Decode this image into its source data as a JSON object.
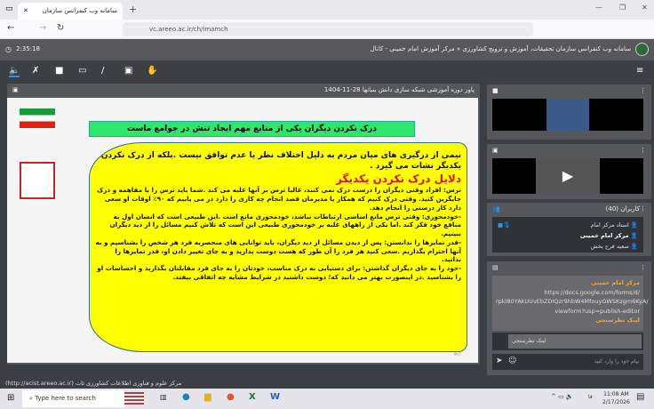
{
  "browser": {
    "tab_title": "سامانه وب کنفرانس سازمان",
    "url": "vc.areeo.ac.ir/ch/imamch",
    "new_tab": "+"
  },
  "app": {
    "title": "سامانه وب کنفرانس سازمان تحقیقات، آموزش و ترویج کشاورزی » مرکز آموزش امام خمینی - کانال",
    "timer": "2:35:18"
  },
  "presentation": {
    "header": "پاور دوره آموزشی شبکه سازی دانش بنیانها 28-11-1404",
    "heading": "درک نکردن دیگران یکی از منابع مهم ایجاد تنش در جوامع ماست",
    "intro": "نیمی از درگیری های میان مردم به دلیل اختلاف نظر یا عدم توافق نیست .بلکه از درک نکردن یکدیگر نشات می گیرد .",
    "subtitle": "دلایل درک نکردن یکدیگر",
    "p1": "ترس: افراد وقتی دیگران را درست درک نمی کنند، غالبا ترس بر آنها غلبه می کند .شما باید ترس را با مفاهمه و درک جایگزین کنید. وقتی درک کنیم که همکار یا مدیرمان قصد انجام چه کاری را دارد در می یابیم که ۹۰٪ اوقات او سعی دارد کار درستی را انجام دهد.",
    "p2": "-خودمحوری: وقتی ترس مانع اساسی ارتباطات نباشد، خودمحوری مانع است .این طبیعی است که انسان اول به منافع خود فکر کند .اما یکی از راههای غلبه بر خودمحوری طبیعی این است که تلاش کنیم مسائل را از دید دیگران ببینیم.",
    "p3": "-قدر تمایزها را ندانستن: پس از دیدن مسائل از دید دیگران، باید توانایی های منحصربه فرد هر شخص را بشناسیم و به آنها احترام بگذاریم .سعی کنید هر فرد را آن طور که هست دوست بدارید و به جای تغییر دادن او، قدر تمایزها را بدانید.",
    "p4": "-خود را به جای دیگران گذاشتن: برای دستیابی به درک مناسب، خودتان را به جای فرد مقابلتان بگذارید و احساسات او را بشناسید .در اینصورت بهتر می دانید که؛ دوست داشتید در شرایط مشابه چه اتفاقی بیفتد.",
    "page": "40"
  },
  "users": {
    "title": "کاربران (40)",
    "list": [
      "استاد مرکز امام",
      "مرکز امام خمینی",
      "سعید فرج بخش"
    ]
  },
  "chat": {
    "sender": "مرکز امام خمینی",
    "link_lines": [
      "https://docs.google.com/forms/d/",
      "rpkI80YAkUUvEbZDIQzr9hbW4MfouyGWSKzgm6KyA/",
      "viewform?usp=publish-editor"
    ],
    "caption": "لینک نظرسنجی",
    "reply_preview": "لینک نظرسنجی",
    "placeholder": "پیام خود را وارد کنید"
  },
  "footer": "مرکز علوم و فناوری اطلاعات کشاورزی ثات (http://acist.areeo.ac.ir)",
  "taskbar": {
    "search_placeholder": "Type here to search",
    "time": "11:08 AM",
    "date": "2/17/2026",
    "lang": "فا"
  },
  "colors": {
    "accent": "#f5a623",
    "slide_yellow": "#ffff00",
    "heading_green": "#2ee66a",
    "subtitle_red": "#e0101a"
  }
}
